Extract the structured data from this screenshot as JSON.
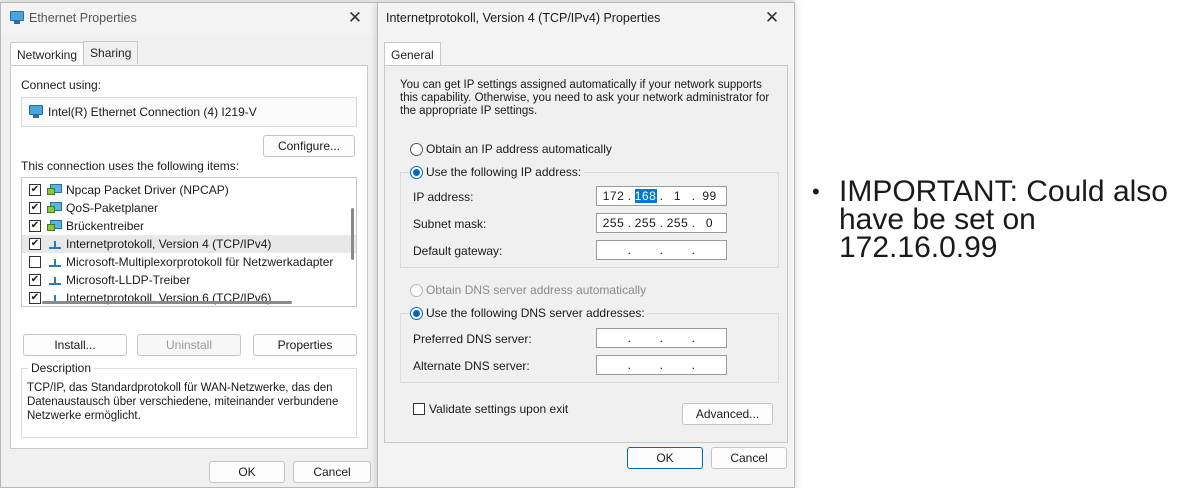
{
  "ethernet": {
    "title": "Ethernet Properties",
    "tabs": [
      "Networking",
      "Sharing"
    ],
    "connect_using_label": "Connect using:",
    "adapter": "Intel(R) Ethernet Connection (4) I219-V",
    "configure_label": "Configure...",
    "items_label": "This connection uses the following items:",
    "items": [
      {
        "checked": true,
        "icon": "component-icon",
        "label": "Npcap Packet Driver (NPCAP)"
      },
      {
        "checked": true,
        "icon": "component-icon",
        "label": "QoS-Paketplaner"
      },
      {
        "checked": true,
        "icon": "component-icon",
        "label": "Brückentreiber"
      },
      {
        "checked": true,
        "icon": "protocol-icon",
        "label": "Internetprotokoll, Version 4 (TCP/IPv4)"
      },
      {
        "checked": false,
        "icon": "protocol-icon",
        "label": "Microsoft-Multiplexorprotokoll für Netzwerkadapter"
      },
      {
        "checked": true,
        "icon": "protocol-icon",
        "label": "Microsoft-LLDP-Treiber"
      },
      {
        "checked": true,
        "icon": "protocol-icon",
        "label": "Internetprotokoll, Version 6 (TCP/IPv6)"
      }
    ],
    "install_label": "Install...",
    "uninstall_label": "Uninstall",
    "properties_label": "Properties",
    "description_label": "Description",
    "description_text": "TCP/IP, das Standardprotokoll für WAN-Netzwerke, das den Datenaustausch über verschiedene, miteinander verbundene Netzwerke ermöglicht.",
    "ok_label": "OK",
    "cancel_label": "Cancel"
  },
  "ipv4": {
    "title": "Internetprotokoll, Version 4 (TCP/IPv4) Properties",
    "tab": "General",
    "intro": "You can get IP settings assigned automatically if your network supports this capability. Otherwise, you need to ask your network administrator for the appropriate IP settings.",
    "obtain_ip_auto": "Obtain an IP address automatically",
    "use_following_ip": "Use the following IP address:",
    "ip_address_label": "IP address:",
    "ip_address": [
      "172",
      "168",
      "1",
      "99"
    ],
    "subnet_mask_label": "Subnet mask:",
    "subnet_mask": [
      "255",
      "255",
      "255",
      "0"
    ],
    "default_gateway_label": "Default gateway:",
    "obtain_dns_auto": "Obtain DNS server address automatically",
    "use_following_dns": "Use the following DNS server addresses:",
    "preferred_dns_label": "Preferred DNS server:",
    "alternate_dns_label": "Alternate DNS server:",
    "validate_label": "Validate settings upon exit",
    "advanced_label": "Advanced...",
    "ok_label": "OK",
    "cancel_label": "Cancel"
  },
  "note": {
    "text": "IMPORTANT: Could also have be set on 172.16.0.99"
  },
  "colors": {
    "accent": "#0067c0",
    "selection": "#0078d7",
    "dialog_bg": "#f0f0f0"
  }
}
